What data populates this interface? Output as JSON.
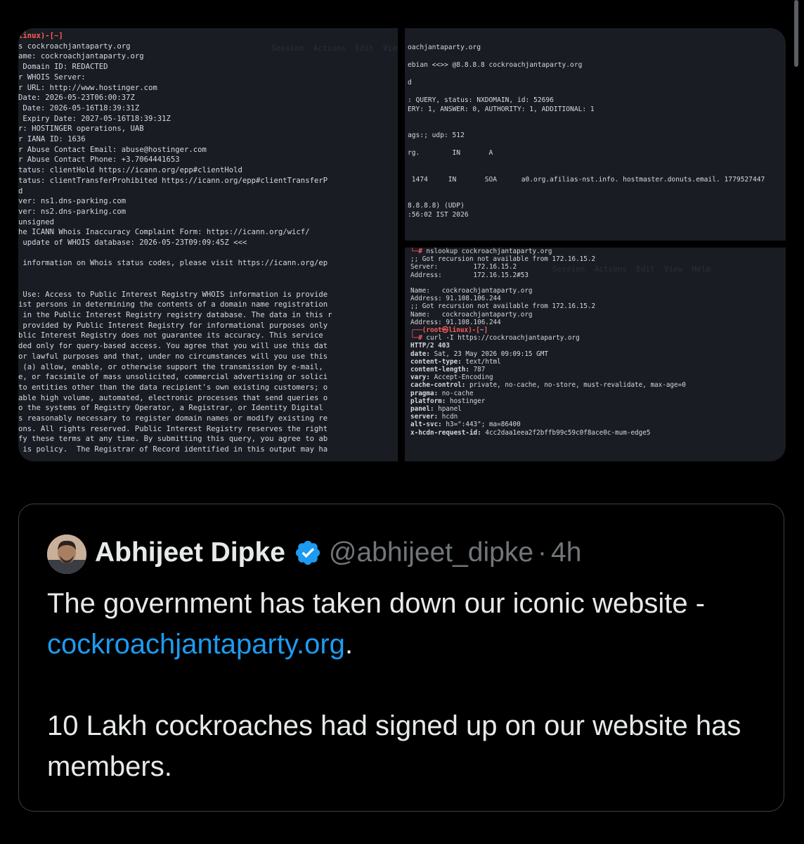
{
  "terminal_left": {
    "prompt": "linux)-[~]",
    "lines": [
      "s cockroachjantaparty.org",
      "ame: cockroachjantaparty.org",
      " Domain ID: REDACTED",
      "r WHOIS Server:",
      "r URL: http://www.hostinger.com",
      "Date: 2026-05-23T06:00:37Z",
      " Date: 2026-05-16T18:39:31Z",
      " Expiry Date: 2027-05-16T18:39:31Z",
      "r: HOSTINGER operations, UAB",
      "r IANA ID: 1636",
      "r Abuse Contact Email: abuse@hostinger.com",
      "r Abuse Contact Phone: +3.7064441653",
      "tatus: clientHold https://icann.org/epp#clientHold",
      "tatus: clientTransferProhibited https://icann.org/epp#clientTransferP",
      "d",
      "ver: ns1.dns-parking.com",
      "ver: ns2.dns-parking.com",
      "unsigned",
      "he ICANN Whois Inaccuracy Complaint Form: https://icann.org/wicf/",
      " update of WHOIS database: 2026-05-23T09:09:45Z <<<",
      "",
      " information on Whois status codes, please visit https://icann.org/ep",
      "",
      "",
      " Use: Access to Public Interest Registry WHOIS information is provide",
      "ist persons in determining the contents of a domain name registration",
      " in the Public Interest Registry registry database. The data in this r",
      " provided by Public Interest Registry for informational purposes only",
      "blic Interest Registry does not guarantee its accuracy. This service",
      "ded only for query-based access. You agree that you will use this dat",
      "or lawful purposes and that, under no circumstances will you use this",
      " (a) allow, enable, or otherwise support the transmission by e-mail,",
      "e, or facsimile of mass unsolicited, commercial advertising or solici",
      "to entities other than the data recipient's own existing customers; o",
      "able high volume, automated, electronic processes that send queries o",
      "o the systems of Registry Operator, a Registrar, or Identity Digital",
      "s reasonably necessary to register domain names or modify existing re",
      "ons. All rights reserved. Public Interest Registry reserves the right",
      "fy these terms at any time. By submitting this query, you agree to ab",
      " is policy.  The Registrar of Record identified in this output may ha"
    ]
  },
  "terminal_top_right": {
    "lines": [
      "oachjantaparty.org",
      "",
      "ebian <<>> @8.8.8.8 cockroachjantaparty.org",
      "",
      "d",
      "",
      ": QUERY, status: NXDOMAIN, id: 52696",
      "ERY: 1, ANSWER: 0, AUTHORITY: 1, ADDITIONAL: 1",
      "",
      "",
      "ags:; udp: 512",
      "",
      "rg.        IN       A",
      "",
      "",
      " 1474     IN       SOA      a0.org.afilias-nst.info. hostmaster.donuts.email. 1779527447",
      "",
      "",
      "8.8.8.8) (UDP)",
      ":56:02 IST 2026"
    ]
  },
  "terminal_bottom_right": {
    "nslookup_cmd": "nslookup cockroachjantaparty.org",
    "nslookup_lines": [
      ";; Got recursion not available from 172.16.15.2",
      "Server:         172.16.15.2",
      "Address:        172.16.15.2#53",
      "",
      "Name:   cockroachjantaparty.org",
      "Address: 91.108.106.244",
      ";; Got recursion not available from 172.16.15.2",
      "Name:   cockroachjantaparty.org",
      "Address: 91.108.106.244"
    ],
    "prompt_user": "root㉿linux",
    "prompt_dir": "~",
    "curl_cmd": "curl -I https://cockroachjantaparty.org",
    "headers": [
      {
        "key": "HTTP/2 403",
        "val": ""
      },
      {
        "key": "date",
        "val": " Sat, 23 May 2026 09:09:15 GMT"
      },
      {
        "key": "content-type",
        "val": " text/html"
      },
      {
        "key": "content-length",
        "val": " 787"
      },
      {
        "key": "vary",
        "val": " Accept-Encoding"
      },
      {
        "key": "cache-control",
        "val": " private, no-cache, no-store, must-revalidate, max-age=0"
      },
      {
        "key": "pragma",
        "val": " no-cache"
      },
      {
        "key": "platform",
        "val": " hostinger"
      },
      {
        "key": "panel",
        "val": " hpanel"
      },
      {
        "key": "server",
        "val": " hcdn"
      },
      {
        "key": "alt-svc",
        "val": " h3=\":443\"; ma=86400"
      },
      {
        "key": "x-hcdn-request-id",
        "val": " 4cc2daa1eea2f2bffb99c59c0f8ace0c-mum-edge5"
      }
    ]
  },
  "tweet": {
    "author_name": "Abhijeet Dipke",
    "handle": "@abhijeet_dipke",
    "separator": "·",
    "time": "4h",
    "text_1": "The government has taken down our iconic website - ",
    "link": "cockroachjantaparty.org",
    "text_1_end": ".",
    "text_2": "10 Lakh cockroaches had signed up on our website has members.",
    "verified_color": "#1d9bf0",
    "link_color": "#1d9bf0"
  }
}
